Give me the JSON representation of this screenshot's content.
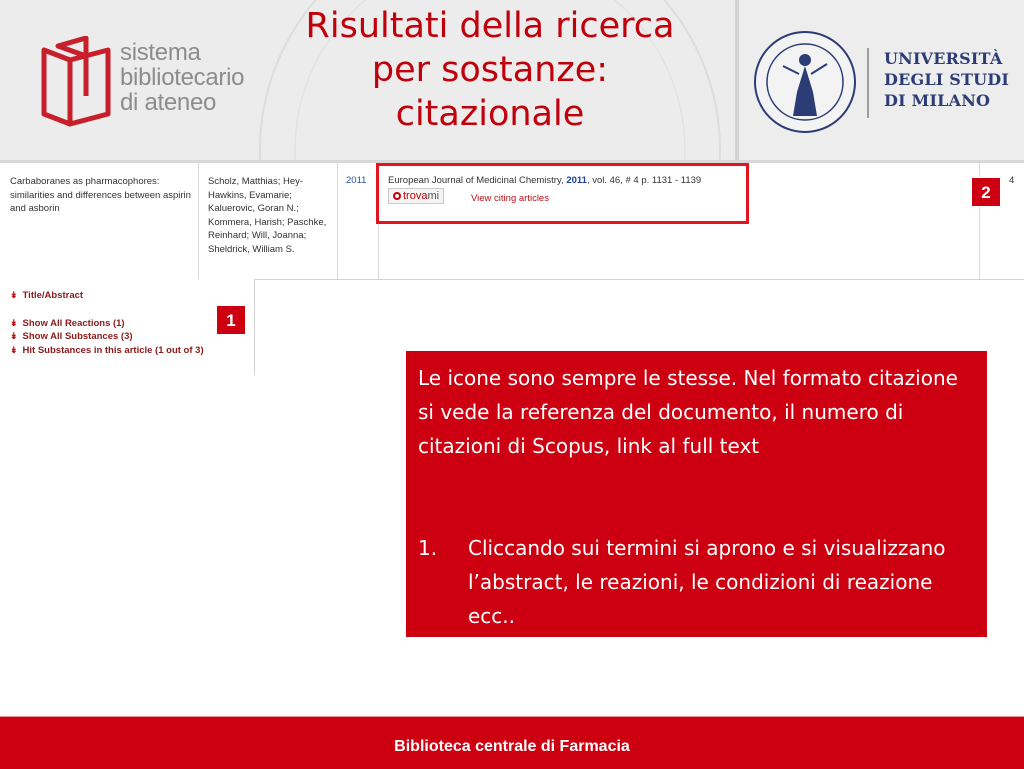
{
  "header": {
    "logo_left": {
      "lines": [
        "sistema",
        "bibliotecario",
        "di ateneo"
      ]
    },
    "title_lines": [
      "Risultati della ricerca",
      "per sostanze:",
      "citazionale"
    ],
    "logo_right": {
      "lines": [
        "UNIVERSITÀ",
        "DEGLI STUDI",
        "DI MILANO"
      ]
    }
  },
  "result_row": {
    "title": "Carbaboranes as pharmacophores: similarities and differences between aspirin and asborin",
    "authors": "Scholz, Matthias; Hey-Hawkins, Evamarie; Kaluerovic, Goran N.; Kommera, Harish; Paschke, Reinhard; Will, Joanna; Sheldrick, William S.",
    "year": "2011",
    "citation": {
      "journal": "European Journal of Medicinal Chemistry,",
      "year": "2011",
      "rest": ", vol. 46, # 4  p. 1131 - 1139"
    },
    "trovami": {
      "text": "trova",
      "suffix": "mi"
    },
    "view_citing": "View citing articles",
    "count": "4"
  },
  "badges": {
    "one": "1",
    "two": "2"
  },
  "links": [
    "Title/Abstract",
    "Show All Reactions (1)",
    "Show All Substances (3)",
    "Hit Substances in this article (1 out of 3)"
  ],
  "info": {
    "paragraph": "Le icone sono sempre le stesse. Nel formato citazione si vede la referenza del documento, il numero di citazioni di Scopus, link al full text",
    "item_number": "1.",
    "item_text": "Cliccando sui termini si aprono e si visualizzano l’abstract, le reazioni, le condizioni di reazione ecc.."
  },
  "footer": {
    "text": "Biblioteca centrale di Farmacia"
  },
  "colors": {
    "accent_red": "#cc0011",
    "title_red": "#c0000a",
    "uni_blue": "#2c3c74",
    "logo_grey": "#8c8c8c"
  }
}
